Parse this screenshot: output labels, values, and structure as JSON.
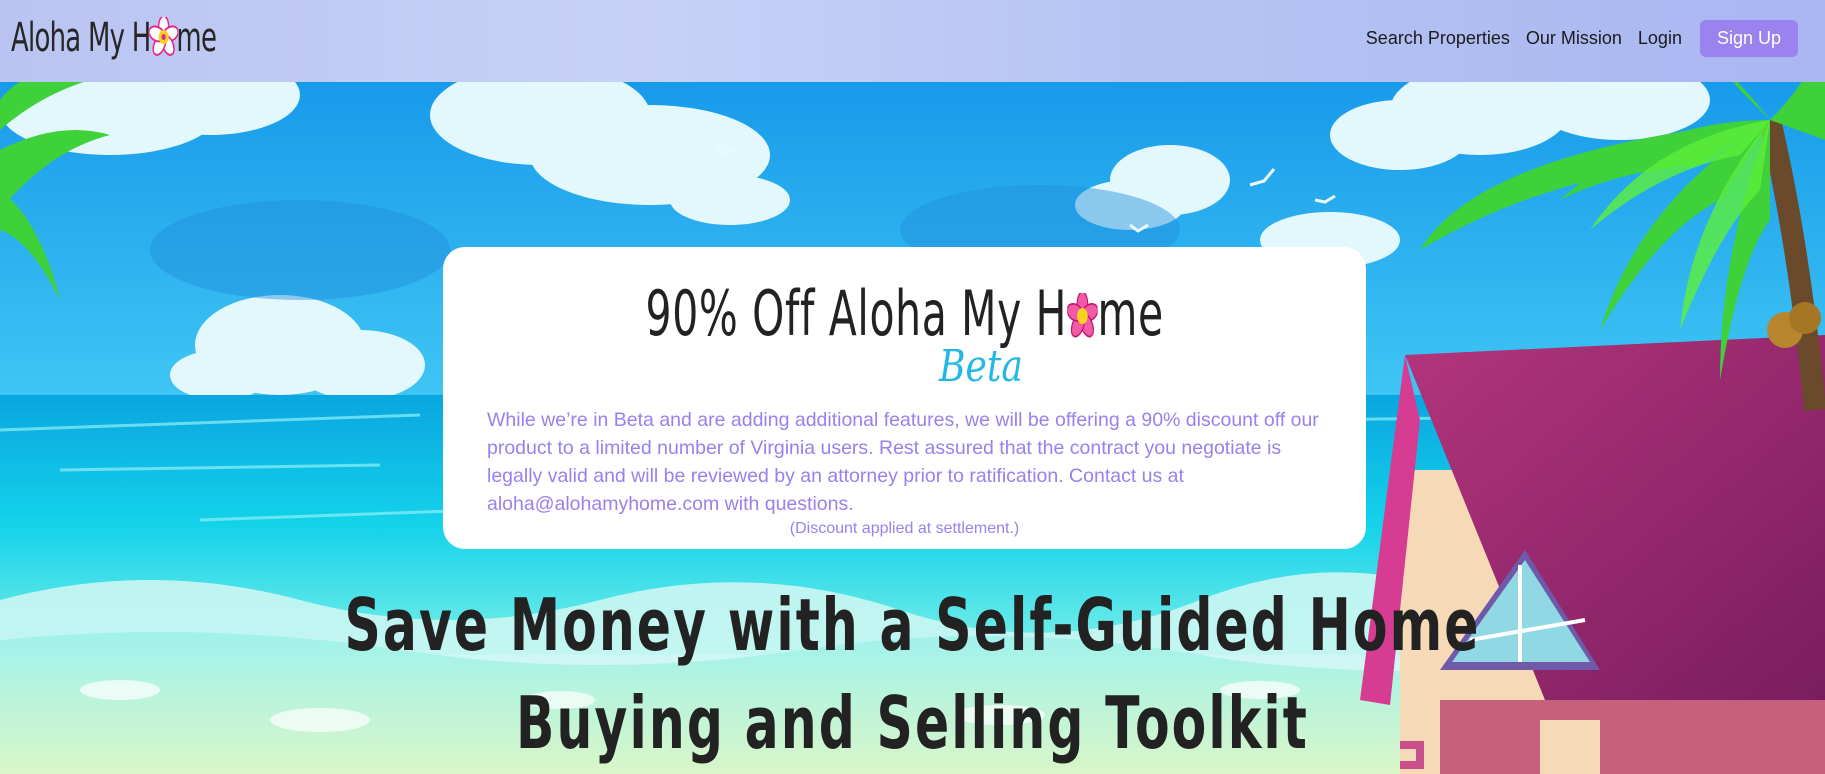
{
  "brand": {
    "name_prefix": "Aloha My H",
    "name_suffix": "me",
    "logo_icon": "plumeria-flower-icon"
  },
  "nav": {
    "links": [
      "Search Properties",
      "Our Mission",
      "Login"
    ],
    "signup_label": "Sign Up"
  },
  "promo": {
    "heading_prefix": "90% Off Aloha My H",
    "heading_suffix": "me",
    "beta": "Beta",
    "body": "While we’re in Beta and are adding additional features, we will be offering a 90% discount off our product to a limited number of Virginia users. Rest assured that the contract you negotiate is legally valid and will be reviewed by an attorney prior to ratification. Contact us at aloha@alohamyhome.com with questions.",
    "note": "(Discount applied at settlement.)"
  },
  "hero": {
    "line1": "Save Money with a Self-Guided Home",
    "line2": "Buying and Selling Toolkit"
  },
  "colors": {
    "accent": "#9a83ee",
    "body_text": "#9a80ec",
    "beta": "#22b8e6",
    "flower_pink": "#e8258d",
    "flower_yellow": "#f7d21e"
  }
}
